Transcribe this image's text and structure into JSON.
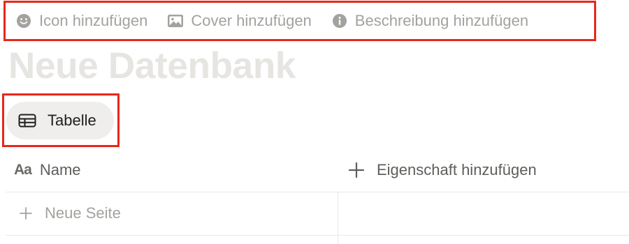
{
  "actions": [
    {
      "label": "Icon hinzufügen",
      "icon": "smiley-icon"
    },
    {
      "label": "Cover hinzufügen",
      "icon": "image-icon"
    },
    {
      "label": "Beschreibung hinzufügen",
      "icon": "info-icon"
    }
  ],
  "title": "Neue Datenbank",
  "view_tab": {
    "label": "Tabelle",
    "icon": "table-icon"
  },
  "table": {
    "name_column_icon": "Aa",
    "name_column_label": "Name",
    "add_property_label": "Eigenschaft hinzufügen",
    "new_row_label": "Neue Seite"
  },
  "colors": {
    "highlight": "#e8271a",
    "muted_text": "#a3a29e",
    "title_placeholder": "#e6e5e2",
    "tab_background": "#efeeec"
  }
}
